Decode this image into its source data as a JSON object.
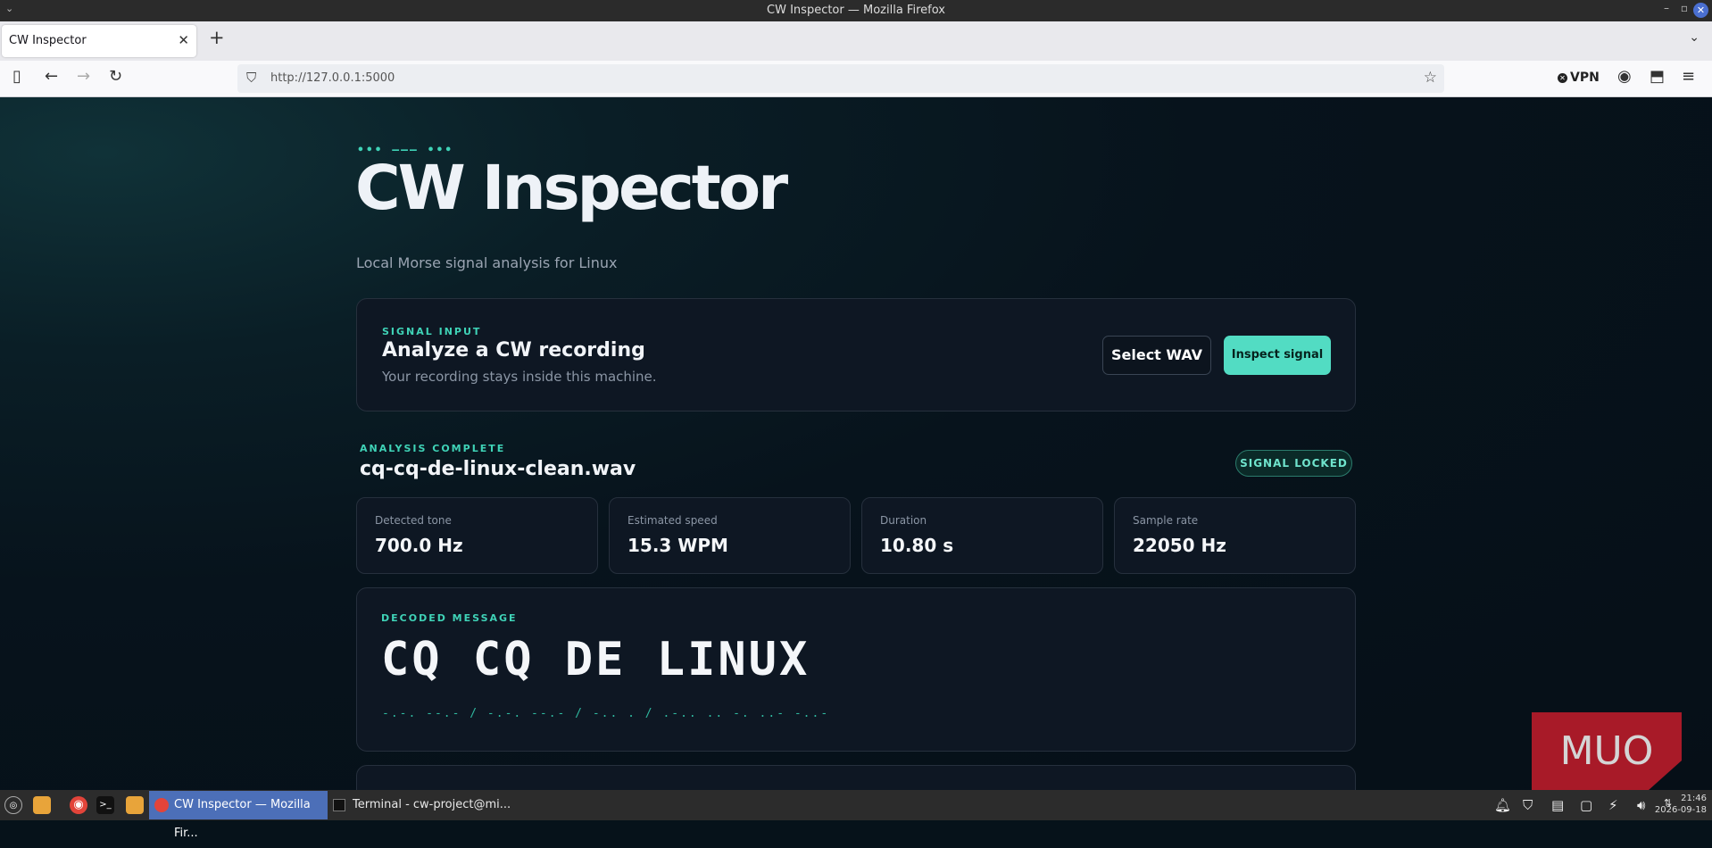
{
  "window": {
    "title": "CW Inspector — Mozilla Firefox"
  },
  "browser": {
    "tab_title": "CW Inspector",
    "url": "http://127.0.0.1:5000",
    "vpn_label": "VPN"
  },
  "hero": {
    "morse": "••• ––– •••",
    "title": "CW Inspector",
    "subtitle": "Local Morse signal analysis for Linux"
  },
  "input_card": {
    "eyebrow": "SIGNAL INPUT",
    "title": "Analyze a CW recording",
    "description": "Your recording stays inside this machine.",
    "select_button": "Select WAV",
    "inspect_button": "Inspect signal"
  },
  "analysis": {
    "eyebrow": "ANALYSIS COMPLETE",
    "filename": "cq-cq-de-linux-clean.wav",
    "badge": "SIGNAL LOCKED",
    "stats": [
      {
        "label": "Detected tone",
        "value": "700.0 Hz"
      },
      {
        "label": "Estimated speed",
        "value": "15.3 WPM"
      },
      {
        "label": "Duration",
        "value": "10.80 s"
      },
      {
        "label": "Sample rate",
        "value": "22050 Hz"
      }
    ]
  },
  "decoded": {
    "eyebrow": "DECODED MESSAGE",
    "text": "CQ CQ DE LINUX",
    "morse": "-.-. --.- / -.-. --.- / -.. . / .-.. .. -. ..- -..-"
  },
  "watermark": "MUO",
  "taskbar": {
    "items": [
      {
        "label": "CW Inspector — Mozilla Fir..."
      },
      {
        "label": "Terminal - cw-project@mi..."
      }
    ],
    "time": "21:46",
    "date": "2026-09-18"
  },
  "colors": {
    "accent": "#3fd3b7",
    "button": "#52dcc3",
    "taskbar_active": "#4c6fb8"
  }
}
